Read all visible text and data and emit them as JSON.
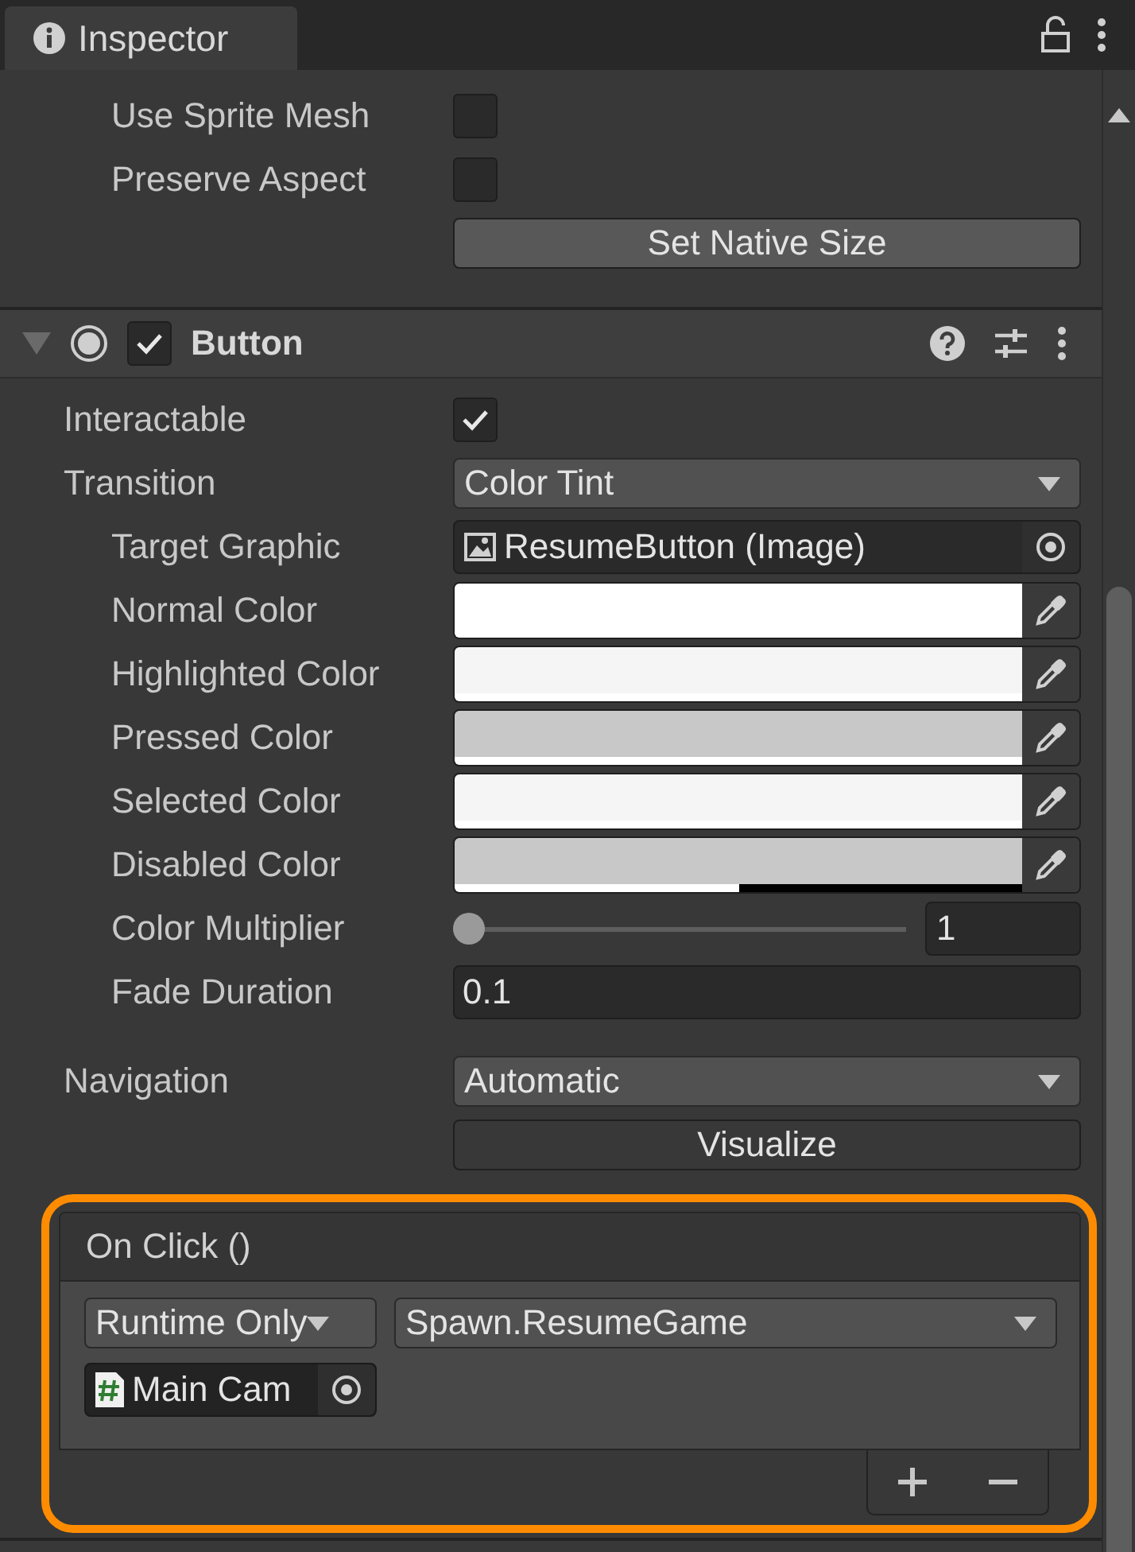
{
  "window": {
    "tab": "Inspector",
    "locked": false
  },
  "image_section": {
    "rows": [
      {
        "kind": "checkbox",
        "label": "Use Sprite Mesh",
        "checked": false
      },
      {
        "kind": "checkbox",
        "label": "Preserve Aspect",
        "checked": false
      }
    ],
    "action": "Set Native Size"
  },
  "component": {
    "title": "Button",
    "enabled": true,
    "expanded": true,
    "rows": [
      {
        "kind": "checkbox",
        "label": "Interactable",
        "checked": true
      },
      {
        "kind": "dropdown",
        "label": "Transition",
        "value": "Color Tint",
        "children": [
          {
            "kind": "object",
            "label": "Target Graphic",
            "value": "ResumeButton (Image)"
          },
          {
            "kind": "color",
            "label": "Normal Color",
            "color": "#ffffff",
            "level": 1
          },
          {
            "kind": "color",
            "label": "Highlighted Color",
            "color": "#f5f5f5",
            "level": 1
          },
          {
            "kind": "color",
            "label": "Pressed Color",
            "color": "#c8c8c8",
            "level": 1
          },
          {
            "kind": "color",
            "label": "Selected Color",
            "color": "#f5f5f5",
            "level": 1
          },
          {
            "kind": "color",
            "label": "Disabled Color",
            "color": "#c8c8c8",
            "level": 0.5
          },
          {
            "kind": "slider",
            "label": "Color Multiplier",
            "level": 0,
            "reading": "1"
          },
          {
            "kind": "number",
            "label": "Fade Duration",
            "value": "0.1"
          }
        ]
      },
      {
        "kind": "gap"
      },
      {
        "kind": "dropdown",
        "label": "Navigation",
        "value": "Automatic"
      },
      {
        "kind": "button",
        "value": "Visualize"
      }
    ],
    "event": {
      "title": "On Click ()",
      "highlighted": true,
      "entries": [
        {
          "mode": "Runtime Only",
          "function": "Spawn.ResumeGame",
          "target": "Main Cam"
        }
      ]
    }
  }
}
